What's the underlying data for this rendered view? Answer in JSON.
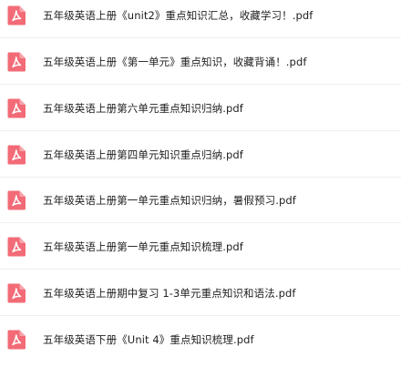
{
  "files": [
    {
      "name": "五年级英语上册《unit2》重点知识汇总，收藏学习！.pdf",
      "icon": "pdf-file-icon"
    },
    {
      "name": "五年级英语上册《第一单元》重点知识，收藏背诵！.pdf",
      "icon": "pdf-file-icon"
    },
    {
      "name": "五年级英语上册第六单元重点知识归纳.pdf",
      "icon": "pdf-file-icon"
    },
    {
      "name": "五年级英语上册第四单元知识重点归纳.pdf",
      "icon": "pdf-file-icon"
    },
    {
      "name": "五年级英语上册第一单元重点知识归纳，暑假预习.pdf",
      "icon": "pdf-file-icon"
    },
    {
      "name": "五年级英语上册第一单元重点知识梳理.pdf",
      "icon": "pdf-file-icon"
    },
    {
      "name": "五年级英语上册期中复习 1-3单元重点知识和语法.pdf",
      "icon": "pdf-file-icon"
    },
    {
      "name": "五年级英语下册《Unit 4》重点知识梳理.pdf",
      "icon": "pdf-file-icon"
    }
  ],
  "colors": {
    "icon_background": "#f26b77",
    "icon_glyph": "#ffffff",
    "text": "#1f1f1f",
    "divider": "#efefef"
  }
}
